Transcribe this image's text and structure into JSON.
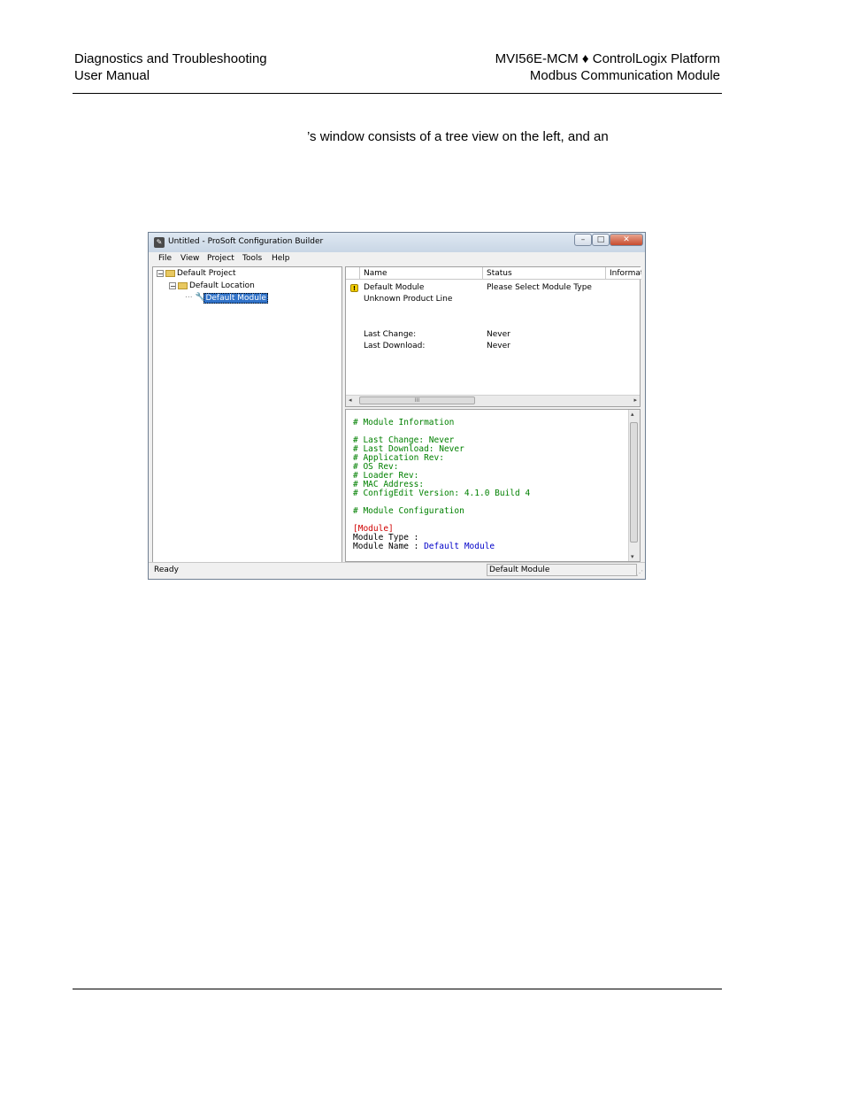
{
  "header": {
    "left_line1": "Diagnostics and Troubleshooting",
    "left_line2": "User Manual",
    "right_line1": "MVI56E-MCM ♦ ControlLogix Platform",
    "right_line2": "Modbus Communication Module"
  },
  "intro_text": "’s window consists of a tree view on the left, and an",
  "window": {
    "title": "Untitled - ProSoft Configuration Builder",
    "menu": [
      "File",
      "View",
      "Project",
      "Tools",
      "Help"
    ],
    "tree": {
      "project": "Default Project",
      "location": "Default Location",
      "module": "Default Module"
    },
    "list": {
      "columns": [
        "Name",
        "Status",
        "Informat"
      ],
      "rows": [
        {
          "name": "Default Module",
          "status": "Please Select Module Type"
        },
        {
          "name": "Unknown Product Line",
          "status": ""
        },
        {
          "name": "Last Change:",
          "status": "Never"
        },
        {
          "name": "Last Download:",
          "status": "Never"
        }
      ],
      "scroll_grip": "III"
    },
    "config": {
      "lines": [
        "# Module Information",
        "# Last Change: Never",
        "# Last Download: Never",
        "# Application Rev:",
        "# OS Rev:",
        "# Loader Rev:",
        "# MAC Address:",
        "# ConfigEdit Version: 4.1.0 Build 4",
        "# Module Configuration",
        "[Module]",
        "Module Type :",
        "Module Name : ",
        "Default Module"
      ]
    },
    "status": {
      "left": "Ready",
      "pane": "Default Module"
    }
  },
  "colors": {
    "comment": "#008000",
    "section": "#d00000",
    "value": "#0000c8",
    "selection": "#3072c8"
  }
}
